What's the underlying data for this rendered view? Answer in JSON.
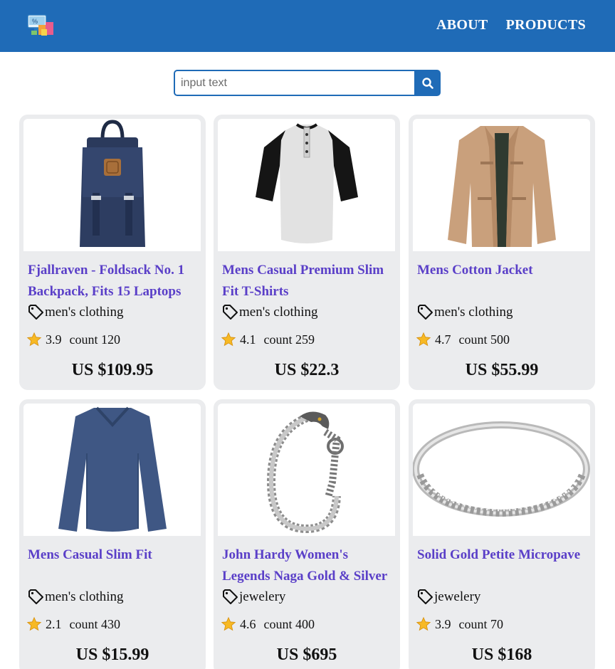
{
  "navbar": {
    "logo_icon": "shop-logo-icon",
    "links": [
      "ABOUT",
      "PRODUCTS"
    ],
    "background": "#1f6bb7"
  },
  "search": {
    "placeholder": "input text",
    "value": "",
    "button_icon": "search-icon"
  },
  "products": [
    {
      "title": "Fjallraven - Foldsack No. 1 Backpack, Fits 15 Laptops",
      "category": "men's clothing",
      "rate": "3.9",
      "count": "count 120",
      "price": "US $109.95",
      "image": "backpack"
    },
    {
      "title": "Mens Casual Premium Slim Fit T-Shirts",
      "category": "men's clothing",
      "rate": "4.1",
      "count": "count 259",
      "price": "US $22.3",
      "image": "tshirt"
    },
    {
      "title": "Mens Cotton Jacket",
      "category": "men's clothing",
      "rate": "4.7",
      "count": "count 500",
      "price": "US $55.99",
      "image": "jacket"
    },
    {
      "title": "Mens Casual Slim Fit",
      "category": "men's clothing",
      "rate": "2.1",
      "count": "count 430",
      "price": "US $15.99",
      "image": "longsleeve"
    },
    {
      "title": "John Hardy Women's Legends Naga Gold & Silver Dragon Station Chain Bracelet",
      "category": "jewelery",
      "rate": "4.6",
      "count": "count 400",
      "price": "US $695",
      "image": "bracelet"
    },
    {
      "title": "Solid Gold Petite Micropave",
      "category": "jewelery",
      "rate": "3.9",
      "count": "count 70",
      "price": "US $168",
      "image": "ring"
    }
  ],
  "colors": {
    "accent": "#1f6bb7",
    "title": "#5a3fc8",
    "card_bg": "#ebecee",
    "star": "#f7b924"
  }
}
